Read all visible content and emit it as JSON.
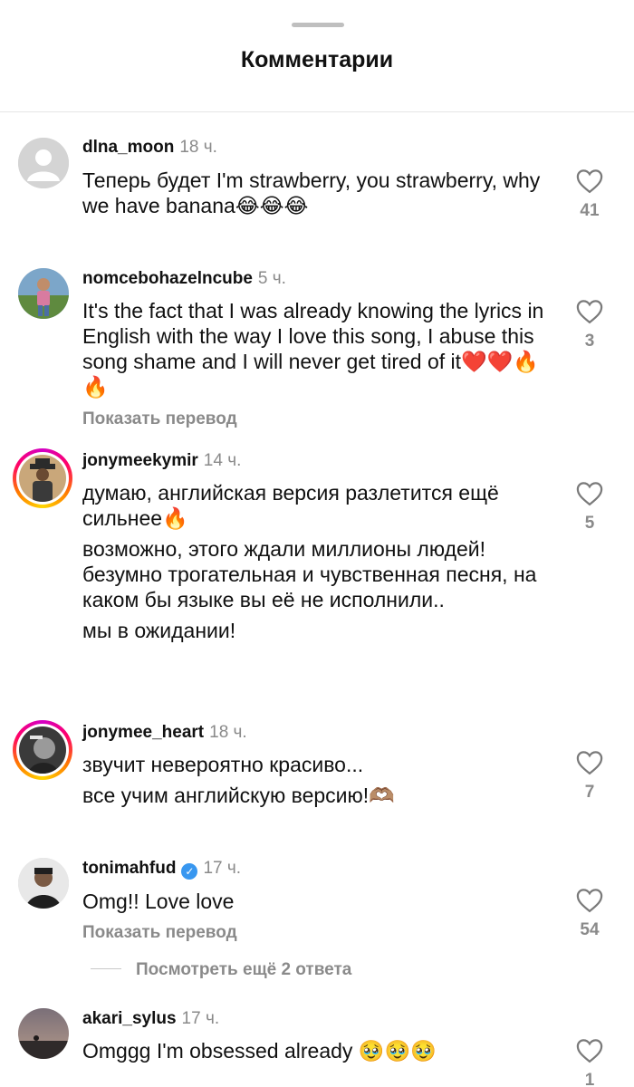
{
  "sheet": {
    "title": "Комментарии"
  },
  "comments": [
    {
      "username": "dlna_moon",
      "time": "18 ч.",
      "lines": [
        "Теперь будет I'm strawberry, you strawberry, why we have banana😂😂😂"
      ],
      "likes": "41"
    },
    {
      "username": "nomcebohazelncube",
      "time": "5 ч.",
      "lines": [
        "It's the fact that I was already knowing the lyrics in English with the way I love this song, I abuse this song shame and I will never get tired of it❤️❤️🔥🔥"
      ],
      "translate": "Показать перевод",
      "likes": "3"
    },
    {
      "username": "jonymeekymir",
      "time": "14 ч.",
      "lines": [
        "думаю, английская версия разлетится ещё сильнее🔥",
        "возможно, этого ждали миллионы людей! безумно трогательная и чувственная песня, на каком бы языке вы её не исполнили..",
        "мы в ожидании!"
      ],
      "likes": "5"
    },
    {
      "username": "jonymee_heart",
      "time": "18 ч.",
      "lines": [
        "звучит невероятно красиво...",
        "все учим английскую версию!🫶🏽"
      ],
      "likes": "7"
    },
    {
      "username": "tonimahfud",
      "verified_icon": "check-icon",
      "time": "17 ч.",
      "lines": [
        "Omg!! Love love"
      ],
      "translate": "Показать перевод",
      "likes": "54"
    },
    {
      "username": "akari_sylus",
      "time": "17 ч.",
      "lines": [
        "Omggg I'm obsessed already 🥹🥹🥹"
      ],
      "likes": "1"
    }
  ],
  "replies": {
    "label": "Посмотреть ещё 2 ответа"
  },
  "colors": {
    "ring_start": "#d300c5",
    "ring_end": "#ffd600",
    "verified": "#3897f0"
  }
}
